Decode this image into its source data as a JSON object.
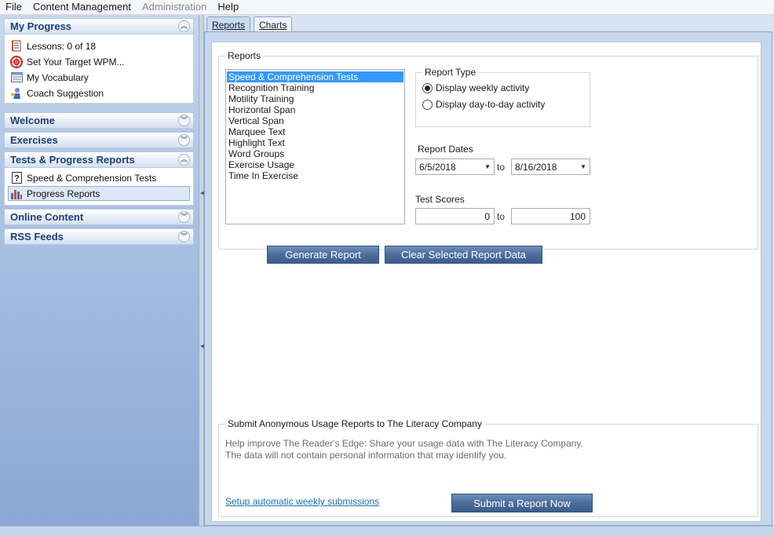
{
  "menu": {
    "file": "File",
    "content_management": "Content Management",
    "administration": "Administration",
    "help": "Help"
  },
  "sidebar": {
    "my_progress": {
      "title": "My Progress",
      "items": [
        {
          "label": "Lessons: 0 of 18",
          "icon": "notebook-icon"
        },
        {
          "label": "Set Your Target WPM...",
          "icon": "target-icon"
        },
        {
          "label": "My Vocabulary",
          "icon": "vocabulary-icon"
        },
        {
          "label": "Coach Suggestion",
          "icon": "coach-icon"
        }
      ]
    },
    "welcome": {
      "title": "Welcome"
    },
    "exercises": {
      "title": "Exercises"
    },
    "tests": {
      "title": "Tests & Progress Reports",
      "items": [
        {
          "label": "Speed & Comprehension Tests",
          "icon": "question-icon"
        },
        {
          "label": "Progress Reports",
          "icon": "bar-chart-icon",
          "selected": true
        }
      ]
    },
    "online_content": {
      "title": "Online Content"
    },
    "rss_feeds": {
      "title": "RSS Feeds"
    }
  },
  "tabs": {
    "reports": "Reports",
    "charts": "Charts"
  },
  "reports_group": {
    "title": "Reports",
    "list": [
      "Speed & Comprehension Tests",
      "Recognition Training",
      "Motility Training",
      "Horizontal Span",
      "Vertical Span",
      "Marquee Text",
      "Highlight Text",
      "Word Groups",
      "Exercise Usage",
      "Time In Exercise"
    ],
    "selected_index": 0
  },
  "report_type": {
    "title": "Report Type",
    "weekly": "Display weekly activity",
    "daily": "Display day-to-day activity",
    "selected": "weekly"
  },
  "report_dates": {
    "label": "Report Dates",
    "from": "6/5/2018",
    "to_label": "to",
    "to": "8/16/2018"
  },
  "test_scores": {
    "label": "Test Scores",
    "min": "0",
    "to_label": "to",
    "max": "100"
  },
  "buttons": {
    "generate": "Generate Report",
    "clear": "Clear Selected Report Data",
    "submit": "Submit a Report Now"
  },
  "submit_group": {
    "title": "Submit Anonymous Usage Reports to The Literacy Company",
    "line1": "Help improve The Reader's Edge: Share your usage data with The Literacy Company.",
    "line2": "The data will not contain personal information that may identify you.",
    "link": "Setup automatic weekly submissions"
  },
  "colors": {
    "header_text": "#1f3f73",
    "button": "#4b6d9c",
    "list_selection": "#3399ff",
    "link": "#1a6fb5"
  }
}
